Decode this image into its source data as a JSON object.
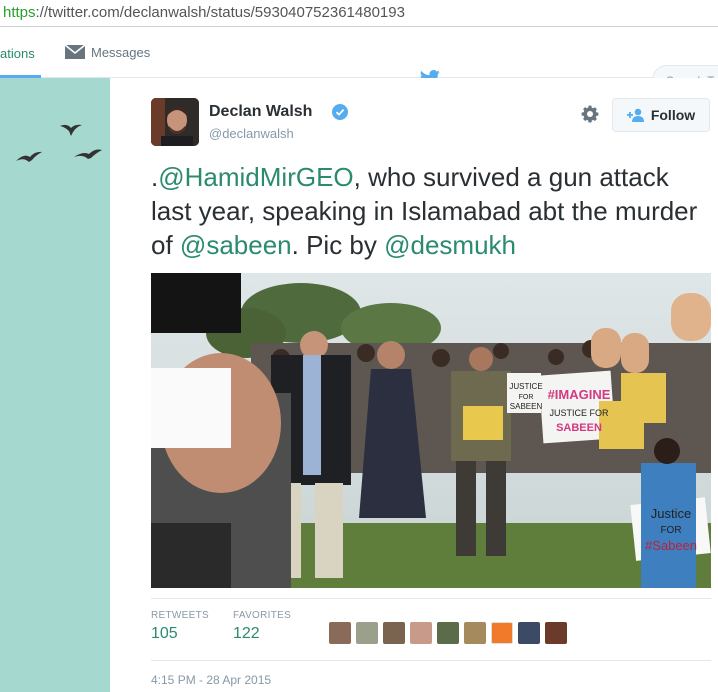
{
  "browser": {
    "url_scheme": "https",
    "url_rest": "://twitter.com/declanwalsh/status/593040752361480193"
  },
  "nav": {
    "notifications_label": "ations",
    "messages_label": "Messages",
    "search_placeholder": "Search Tv"
  },
  "tweet": {
    "name": "Declan Walsh",
    "handle": "@declanwalsh",
    "follow_label": "Follow",
    "text_prefix": ".",
    "mention1": "@HamidMirGEO",
    "text_mid1": ", who survived a gun attack last year, speaking in Islamabad abt the murder of ",
    "mention2": "@sabeen",
    "text_mid2": ". Pic by ",
    "mention3": "@desmukh",
    "photo_signs": {
      "sign1": "#IMAGINE",
      "sign1b": "JUSTICE FOR",
      "sign1c": "SABEEN",
      "sign2": "Justice",
      "sign2b": "FOR",
      "sign2c": "#Sabeen",
      "sign3": "JUSTICE",
      "sign3b": "FOR",
      "sign3c": "SABEEN",
      "sign4": "CE"
    },
    "retweets_label": "RETWEETS",
    "retweets_count": "105",
    "favorites_label": "FAVORITES",
    "favorites_count": "122",
    "timestamp": "4:15 PM - 28 Apr 2015"
  },
  "colors": {
    "mention": "#2a8b6e",
    "left_bg": "#a5d8ce",
    "twitter_blue": "#55acee"
  }
}
